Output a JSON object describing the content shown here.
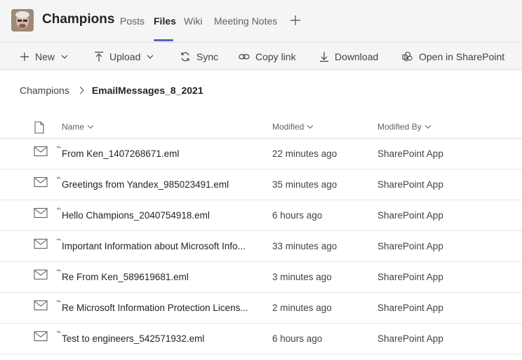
{
  "header": {
    "team_name": "Champions",
    "tabs": [
      {
        "label": "Posts"
      },
      {
        "label": "Files"
      },
      {
        "label": "Wiki"
      },
      {
        "label": "Meeting Notes"
      }
    ],
    "active_tab": "Files"
  },
  "toolbar": {
    "new_label": "New",
    "upload_label": "Upload",
    "sync_label": "Sync",
    "copy_link_label": "Copy link",
    "download_label": "Download",
    "open_sharepoint_label": "Open in SharePoint"
  },
  "breadcrumb": {
    "root": "Champions",
    "current": "EmailMessages_8_2021"
  },
  "table": {
    "columns": {
      "name": "Name",
      "modified": "Modified",
      "modified_by": "Modified By"
    },
    "rows": [
      {
        "name": "From Ken_1407268671.eml",
        "modified": "22 minutes ago",
        "modified_by": "SharePoint App"
      },
      {
        "name": "Greetings from Yandex_985023491.eml",
        "modified": "35 minutes ago",
        "modified_by": "SharePoint App"
      },
      {
        "name": "Hello Champions_2040754918.eml",
        "modified": "6 hours ago",
        "modified_by": "SharePoint App"
      },
      {
        "name": "Important Information about Microsoft Info...",
        "modified": "33 minutes ago",
        "modified_by": "SharePoint App"
      },
      {
        "name": "Re From Ken_589619681.eml",
        "modified": "3 minutes ago",
        "modified_by": "SharePoint App"
      },
      {
        "name": "Re Microsoft Information Protection Licens...",
        "modified": "2 minutes ago",
        "modified_by": "SharePoint App"
      },
      {
        "name": "Test to engineers_542571932.eml",
        "modified": "6 hours ago",
        "modified_by": "SharePoint App"
      }
    ]
  },
  "colors": {
    "accent": "#5b5fc7",
    "header_bg": "#f5f5f5"
  }
}
